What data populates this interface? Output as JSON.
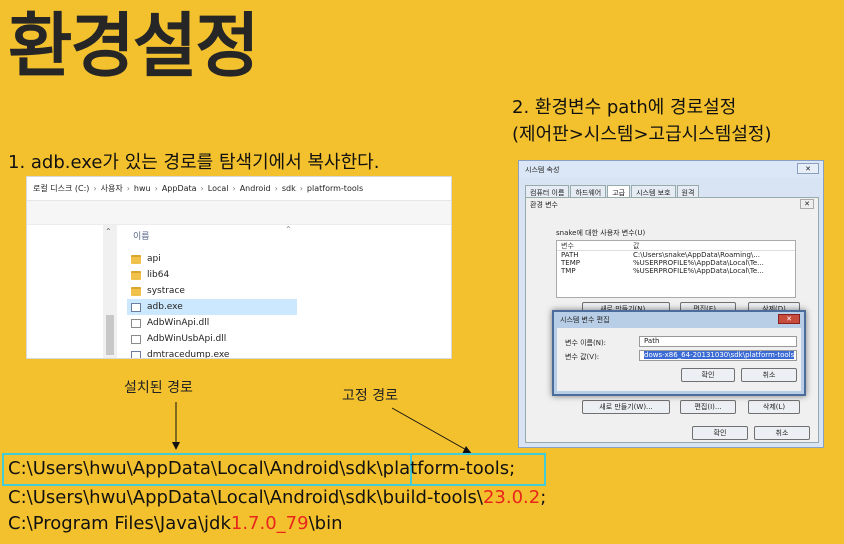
{
  "title": "환경설정",
  "step1": "1. adb.exe가 있는 경로를 탐색기에서 복사한다.",
  "step2": {
    "line1": "2. 환경변수 path에  경로설정",
    "line2": "(제어판>시스템>고급시스템설정)"
  },
  "explorer": {
    "breadcrumb": [
      "로컬 디스크 (C:)",
      "사용자",
      "hwu",
      "AppData",
      "Local",
      "Android",
      "sdk",
      "platform-tools"
    ],
    "column_header": "이름",
    "files": [
      {
        "name": "api",
        "type": "folder"
      },
      {
        "name": "lib64",
        "type": "folder"
      },
      {
        "name": "systrace",
        "type": "folder"
      },
      {
        "name": "adb.exe",
        "type": "exe",
        "selected": true
      },
      {
        "name": "AdbWinApi.dll",
        "type": "dll"
      },
      {
        "name": "AdbWinUsbApi.dll",
        "type": "dll"
      },
      {
        "name": "dmtracedump.exe",
        "type": "exe"
      }
    ]
  },
  "dialog": {
    "title": "시스템 속성",
    "tabs": [
      "컴퓨터 이름",
      "하드웨어",
      "고급",
      "시스템 보호",
      "원격"
    ],
    "env_title": "환경 변수",
    "user_vars_label": "snake에 대한 사용자 변수(U)",
    "table_headers": [
      "변수",
      "값"
    ],
    "user_vars": [
      {
        "name": "PATH",
        "value": "C:\\Users\\snake\\AppData\\Roaming\\..."
      },
      {
        "name": "TEMP",
        "value": "%USERPROFILE%\\AppData\\Local\\Te..."
      },
      {
        "name": "TMP",
        "value": "%USERPROFILE%\\AppData\\Local\\Te..."
      }
    ],
    "buttons_top": [
      "새로 만들기(N)...",
      "편집(E)...",
      "삭제(D)"
    ],
    "buttons_bottom": [
      "새로 만들기(W)...",
      "편집(I)...",
      "삭제(L)"
    ],
    "ok": "확인",
    "cancel": "취소"
  },
  "edit_dialog": {
    "title": "시스템 변수 편집",
    "name_label": "변수 이름(N):",
    "name_value": "Path",
    "value_label": "변수 값(V):",
    "value_value": "dows-x86_64-20131030\\sdk\\platform-tools",
    "ok": "확인",
    "cancel": "취소"
  },
  "annotations": {
    "install_path": "설치된 경로",
    "fixed_path": "고정 경로"
  },
  "paths": {
    "line1_prefix": "C:\\Users\\hwu\\AppData\\Local\\Android\\sdk\\",
    "line1_suffix": "platform-tools",
    "line1_end": ";",
    "line2_prefix": "C:\\Users\\hwu\\AppData\\Local\\Android\\sdk\\build-tools\\",
    "line2_version": "23.0.2",
    "line2_end": ";",
    "line3_prefix": "C:\\Program Files\\Java\\jdk",
    "line3_version": "1.7.0_79",
    "line3_end": "\\bin"
  },
  "colors": {
    "background": "#f4c12e",
    "highlight_box": "#43cbd6",
    "version_red": "#e8261c"
  }
}
